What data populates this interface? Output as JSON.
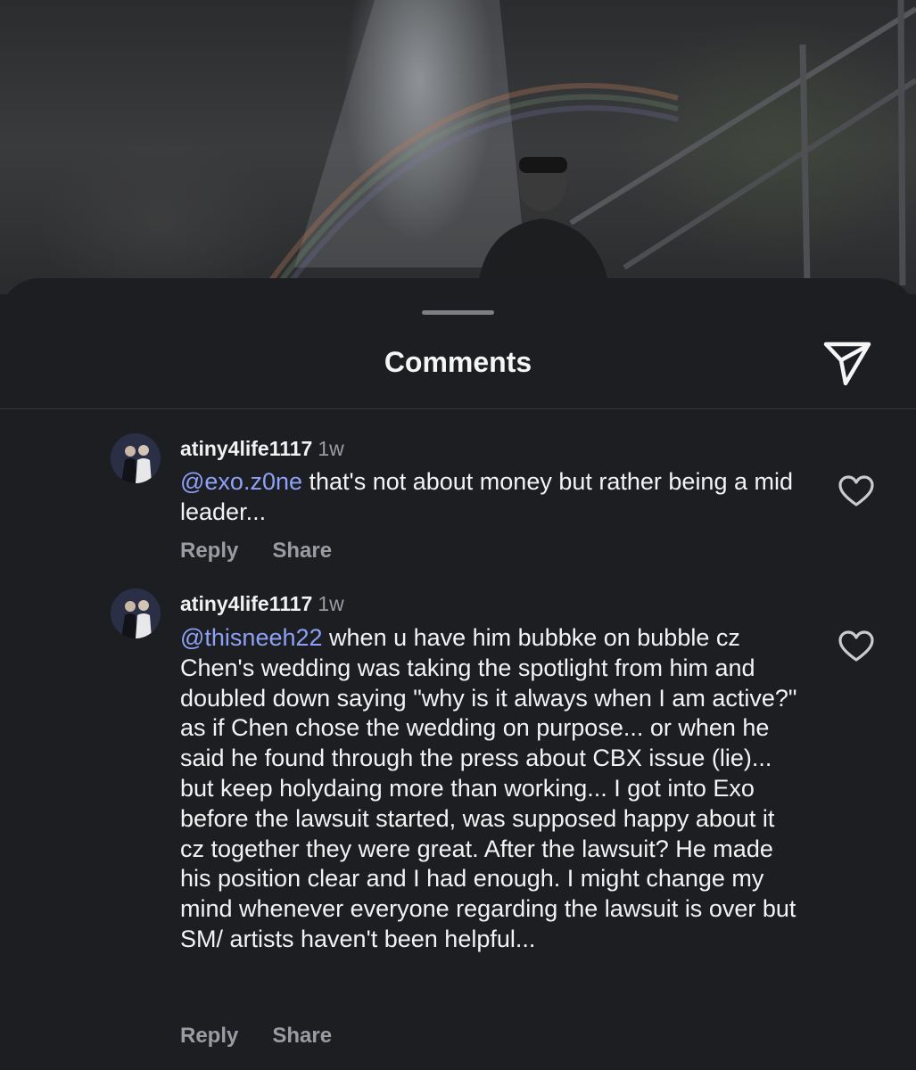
{
  "sheet": {
    "title": "Comments"
  },
  "icons": {
    "send": "send-icon",
    "like": "heart-outline-icon"
  },
  "colors": {
    "background": "#1c1e22",
    "mention": "#8ea1f7",
    "secondary_text": "#9a9ca1"
  },
  "comments": [
    {
      "username": "atiny4life1117",
      "time": "1w",
      "mention": "@exo.z0ne",
      "text": " that's not about money but rather being a mid leader...",
      "reply_label": "Reply",
      "share_label": "Share"
    },
    {
      "username": "atiny4life1117",
      "time": "1w",
      "mention": "@thisneeh22",
      "text": " when u have him bubbke on bubble cz Chen's wedding was taking the spotlight from him and doubled down saying \"why is it always when I am active?\" as if Chen chose the wedding on purpose... or when he said he found through the press about CBX issue (lie)... but keep holydaing more than working... I got into Exo before the lawsuit started, was supposed happy about it cz together they were great. After the lawsuit? He made his position clear and I had enough. I might change my mind whenever everyone regarding the lawsuit is over but SM/ artists haven't been helpful...",
      "reply_label": "Reply",
      "share_label": "Share"
    }
  ]
}
